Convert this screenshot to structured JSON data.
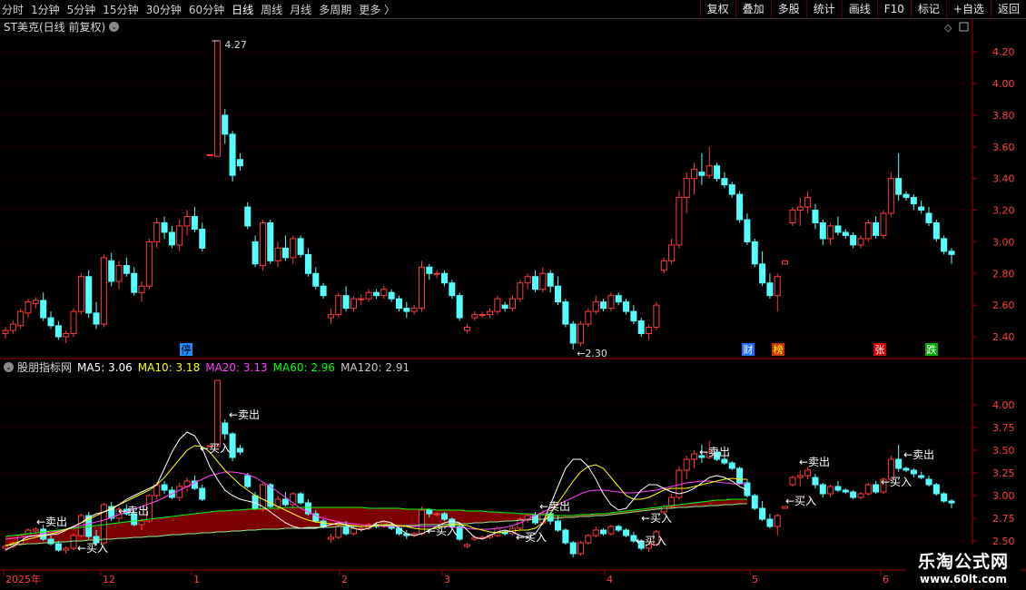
{
  "toolbar": {
    "periods": [
      "分时",
      "1分钟",
      "5分钟",
      "15分钟",
      "30分钟",
      "60分钟",
      "日线",
      "周线",
      "月线",
      "多周期",
      "更多 〉"
    ],
    "active": "日线",
    "right_buttons": [
      "复权",
      "叠加",
      "多股",
      "统计",
      "画线",
      "F10",
      "标记",
      "+自选",
      "返回"
    ]
  },
  "main_panel": {
    "title": "ST美克(日线 前复权)",
    "y_ticks": [
      "4.20",
      "4.00",
      "3.80",
      "3.60",
      "3.40",
      "3.20",
      "3.00",
      "2.80",
      "2.60",
      "2.40"
    ],
    "high_label": "4.27",
    "low_label": "←2.30",
    "markers": [
      "停",
      "财",
      "榜",
      "张",
      "跌"
    ]
  },
  "indicator_panel": {
    "title": "股朋指标网",
    "ma_labels": [
      {
        "text": "MA5: 3.06",
        "color": "#ffffff"
      },
      {
        "text": "MA10: 3.18",
        "color": "#ffff00"
      },
      {
        "text": "MA20: 3.13",
        "color": "#ff40ff"
      },
      {
        "text": "MA60: 2.96",
        "color": "#00ff00"
      },
      {
        "text": "MA120: 2.91",
        "color": "#c8c8c8"
      }
    ],
    "y_ticks": [
      "4.00",
      "3.75",
      "3.50",
      "3.25",
      "3.00",
      "2.75",
      "2.50"
    ],
    "signals": [
      "←卖出",
      "←买入"
    ]
  },
  "x_axis": {
    "labels": [
      "2025年",
      "12",
      "1",
      "2",
      "3",
      "4",
      "5",
      "6"
    ]
  },
  "watermark": {
    "line1": "乐淘公式网",
    "line2": "www.60lt.com"
  },
  "colors": {
    "up": "#ff3b3b",
    "down": "#54ffff",
    "grid": "#5a0000",
    "axis": "#a00000",
    "band": "#8a0000"
  },
  "chart_data": {
    "type": "candlestick",
    "ylim_main": [
      2.3,
      4.27
    ],
    "ylim_indicator": [
      2.5,
      4.0
    ],
    "ohlc": [
      [
        2.42,
        2.46,
        2.39,
        2.44
      ],
      [
        2.44,
        2.5,
        2.42,
        2.48
      ],
      [
        2.47,
        2.58,
        2.45,
        2.56
      ],
      [
        2.55,
        2.64,
        2.52,
        2.62
      ],
      [
        2.61,
        2.65,
        2.58,
        2.63
      ],
      [
        2.63,
        2.68,
        2.5,
        2.52
      ],
      [
        2.52,
        2.56,
        2.45,
        2.47
      ],
      [
        2.47,
        2.5,
        2.38,
        2.4
      ],
      [
        2.4,
        2.44,
        2.36,
        2.42
      ],
      [
        2.42,
        2.58,
        2.4,
        2.56
      ],
      [
        2.56,
        2.8,
        2.54,
        2.78
      ],
      [
        2.78,
        2.82,
        2.52,
        2.55
      ],
      [
        2.55,
        2.62,
        2.45,
        2.48
      ],
      [
        2.48,
        2.92,
        2.46,
        2.9
      ],
      [
        2.88,
        2.93,
        2.72,
        2.75
      ],
      [
        2.75,
        2.88,
        2.7,
        2.85
      ],
      [
        2.85,
        2.9,
        2.78,
        2.8
      ],
      [
        2.8,
        2.84,
        2.66,
        2.68
      ],
      [
        2.68,
        2.75,
        2.62,
        2.72
      ],
      [
        2.72,
        3.02,
        2.7,
        3.0
      ],
      [
        3.0,
        3.15,
        2.96,
        3.12
      ],
      [
        3.12,
        3.16,
        3.02,
        3.06
      ],
      [
        3.06,
        3.1,
        2.96,
        2.98
      ],
      [
        2.98,
        3.14,
        2.94,
        3.1
      ],
      [
        3.1,
        3.2,
        3.04,
        3.16
      ],
      [
        3.16,
        3.22,
        3.06,
        3.08
      ],
      [
        3.08,
        3.12,
        2.94,
        2.96
      ],
      [
        3.55,
        3.55,
        3.55,
        3.55
      ],
      [
        3.54,
        4.27,
        3.54,
        4.27
      ],
      [
        3.8,
        3.84,
        3.62,
        3.68
      ],
      [
        3.68,
        3.7,
        3.38,
        3.42
      ],
      [
        3.52,
        3.56,
        3.45,
        3.48
      ],
      [
        3.22,
        3.25,
        3.08,
        3.1
      ],
      [
        3.0,
        3.04,
        2.84,
        2.86
      ],
      [
        2.85,
        3.14,
        2.82,
        3.12
      ],
      [
        3.12,
        3.14,
        2.86,
        2.88
      ],
      [
        2.88,
        3.0,
        2.84,
        2.96
      ],
      [
        2.96,
        3.04,
        2.88,
        2.9
      ],
      [
        2.9,
        3.04,
        2.86,
        3.02
      ],
      [
        3.02,
        3.04,
        2.9,
        2.92
      ],
      [
        2.92,
        2.96,
        2.78,
        2.8
      ],
      [
        2.8,
        2.84,
        2.7,
        2.72
      ],
      [
        2.72,
        2.74,
        2.64,
        2.66
      ],
      [
        2.52,
        2.58,
        2.48,
        2.54
      ],
      [
        2.54,
        2.68,
        2.52,
        2.66
      ],
      [
        2.66,
        2.72,
        2.56,
        2.58
      ],
      [
        2.58,
        2.66,
        2.56,
        2.64
      ],
      [
        2.64,
        2.67,
        2.6,
        2.64
      ],
      [
        2.64,
        2.7,
        2.62,
        2.68
      ],
      [
        2.68,
        2.7,
        2.64,
        2.66
      ],
      [
        2.66,
        2.72,
        2.64,
        2.7
      ],
      [
        2.68,
        2.7,
        2.62,
        2.64
      ],
      [
        2.64,
        2.66,
        2.56,
        2.58
      ],
      [
        2.58,
        2.62,
        2.52,
        2.56
      ],
      [
        2.56,
        2.6,
        2.54,
        2.58
      ],
      [
        2.58,
        2.88,
        2.56,
        2.84
      ],
      [
        2.84,
        2.86,
        2.76,
        2.8
      ],
      [
        2.8,
        2.82,
        2.77,
        2.8
      ],
      [
        2.8,
        2.82,
        2.72,
        2.74
      ],
      [
        2.74,
        2.76,
        2.64,
        2.66
      ],
      [
        2.66,
        2.68,
        2.5,
        2.52
      ],
      [
        2.44,
        2.48,
        2.42,
        2.46
      ],
      [
        2.52,
        2.56,
        2.5,
        2.54
      ],
      [
        2.54,
        2.56,
        2.52,
        2.54
      ],
      [
        2.54,
        2.58,
        2.52,
        2.56
      ],
      [
        2.56,
        2.66,
        2.54,
        2.64
      ],
      [
        2.6,
        2.62,
        2.56,
        2.58
      ],
      [
        2.58,
        2.66,
        2.56,
        2.64
      ],
      [
        2.64,
        2.76,
        2.62,
        2.74
      ],
      [
        2.74,
        2.8,
        2.7,
        2.78
      ],
      [
        2.78,
        2.82,
        2.68,
        2.7
      ],
      [
        2.7,
        2.84,
        2.68,
        2.8
      ],
      [
        2.8,
        2.82,
        2.68,
        2.72
      ],
      [
        2.72,
        2.78,
        2.6,
        2.62
      ],
      [
        2.62,
        2.64,
        2.46,
        2.48
      ],
      [
        2.48,
        2.5,
        2.32,
        2.36
      ],
      [
        2.36,
        2.5,
        2.34,
        2.48
      ],
      [
        2.48,
        2.58,
        2.46,
        2.56
      ],
      [
        2.56,
        2.66,
        2.54,
        2.62
      ],
      [
        2.62,
        2.64,
        2.56,
        2.58
      ],
      [
        2.58,
        2.68,
        2.56,
        2.66
      ],
      [
        2.66,
        2.68,
        2.6,
        2.62
      ],
      [
        2.62,
        2.64,
        2.54,
        2.56
      ],
      [
        2.56,
        2.6,
        2.48,
        2.5
      ],
      [
        2.5,
        2.52,
        2.4,
        2.42
      ],
      [
        2.42,
        2.48,
        2.38,
        2.46
      ],
      [
        2.46,
        2.62,
        2.44,
        2.6
      ],
      [
        2.82,
        2.9,
        2.8,
        2.88
      ],
      [
        2.88,
        3.02,
        2.86,
        2.98
      ],
      [
        2.98,
        3.32,
        2.96,
        3.28
      ],
      [
        3.28,
        3.44,
        3.18,
        3.4
      ],
      [
        3.4,
        3.5,
        3.3,
        3.46
      ],
      [
        3.44,
        3.56,
        3.36,
        3.42
      ],
      [
        3.42,
        3.6,
        3.4,
        3.48
      ],
      [
        3.48,
        3.5,
        3.38,
        3.4
      ],
      [
        3.4,
        3.44,
        3.34,
        3.36
      ],
      [
        3.36,
        3.38,
        3.28,
        3.3
      ],
      [
        3.3,
        3.32,
        3.12,
        3.14
      ],
      [
        3.14,
        3.18,
        2.98,
        3.0
      ],
      [
        3.0,
        3.02,
        2.84,
        2.86
      ],
      [
        2.86,
        2.94,
        2.72,
        2.74
      ],
      [
        2.74,
        2.8,
        2.64,
        2.66
      ],
      [
        2.66,
        2.8,
        2.56,
        2.78
      ],
      [
        2.86,
        2.88,
        2.86,
        2.88
      ],
      [
        3.12,
        3.22,
        3.1,
        3.2
      ],
      [
        3.2,
        3.28,
        3.1,
        3.22
      ],
      [
        3.22,
        3.32,
        3.18,
        3.28
      ],
      [
        3.2,
        3.24,
        3.08,
        3.12
      ],
      [
        3.12,
        3.14,
        2.98,
        3.02
      ],
      [
        3.02,
        3.12,
        2.98,
        3.1
      ],
      [
        3.1,
        3.16,
        3.04,
        3.06
      ],
      [
        3.06,
        3.08,
        3.02,
        3.04
      ],
      [
        3.04,
        3.06,
        2.96,
        2.98
      ],
      [
        2.98,
        3.04,
        2.96,
        3.02
      ],
      [
        3.02,
        3.14,
        3.0,
        3.12
      ],
      [
        3.12,
        3.16,
        3.02,
        3.04
      ],
      [
        3.04,
        3.2,
        3.02,
        3.18
      ],
      [
        3.18,
        3.44,
        3.16,
        3.4
      ],
      [
        3.4,
        3.56,
        3.26,
        3.3
      ],
      [
        3.3,
        3.32,
        3.26,
        3.28
      ],
      [
        3.28,
        3.3,
        3.2,
        3.24
      ],
      [
        3.22,
        3.26,
        3.18,
        3.2
      ],
      [
        3.18,
        3.22,
        3.1,
        3.12
      ],
      [
        3.12,
        3.14,
        3.0,
        3.02
      ],
      [
        3.02,
        3.04,
        2.92,
        2.94
      ],
      [
        2.94,
        2.96,
        2.86,
        2.92
      ]
    ],
    "ma5": [
      2.4,
      2.44,
      2.5,
      2.55,
      2.56,
      2.56,
      2.57,
      2.58,
      2.62,
      2.66,
      2.7,
      2.76,
      2.8,
      2.82,
      2.85,
      2.9,
      2.96,
      3.0,
      3.04,
      3.08,
      3.12,
      3.3,
      3.48,
      3.62,
      3.7,
      3.66,
      3.52,
      3.32,
      3.18,
      3.06,
      3.0,
      2.96,
      2.94,
      2.92,
      2.88,
      2.82,
      2.76,
      2.7,
      2.66,
      2.64,
      2.64,
      2.64,
      2.66,
      2.68,
      2.7,
      2.68,
      2.64,
      2.62,
      2.64,
      2.7,
      2.72,
      2.7,
      2.64,
      2.58,
      2.56,
      2.58,
      2.62,
      2.66,
      2.7,
      2.72,
      2.7,
      2.62,
      2.54,
      2.52,
      2.56,
      2.6,
      2.62,
      2.6,
      2.56,
      2.54,
      2.58,
      2.7,
      2.9,
      3.1,
      3.3,
      3.4,
      3.4,
      3.32,
      3.18,
      3.02,
      2.9,
      2.84,
      2.86,
      2.96,
      3.06,
      3.12,
      3.12,
      3.08,
      3.04,
      3.02,
      3.04,
      3.08,
      3.14,
      3.2,
      3.22,
      3.2,
      3.16,
      3.1,
      3.06
    ],
    "ma10": [
      2.45,
      2.47,
      2.5,
      2.52,
      2.54,
      2.56,
      2.58,
      2.6,
      2.63,
      2.66,
      2.7,
      2.74,
      2.78,
      2.82,
      2.86,
      2.9,
      2.94,
      2.98,
      3.02,
      3.06,
      3.12,
      3.2,
      3.3,
      3.4,
      3.5,
      3.55,
      3.54,
      3.48,
      3.38,
      3.28,
      3.2,
      3.12,
      3.06,
      3.0,
      2.96,
      2.92,
      2.88,
      2.84,
      2.8,
      2.76,
      2.73,
      2.71,
      2.7,
      2.69,
      2.68,
      2.68,
      2.67,
      2.66,
      2.66,
      2.67,
      2.68,
      2.68,
      2.67,
      2.66,
      2.64,
      2.63,
      2.63,
      2.64,
      2.66,
      2.68,
      2.68,
      2.67,
      2.64,
      2.62,
      2.6,
      2.59,
      2.6,
      2.61,
      2.62,
      2.62,
      2.64,
      2.7,
      2.8,
      2.92,
      3.04,
      3.16,
      3.26,
      3.32,
      3.34,
      3.3,
      3.2,
      3.1,
      3.0,
      2.96,
      2.96,
      2.98,
      3.02,
      3.06,
      3.08,
      3.08,
      3.08,
      3.1,
      3.12,
      3.14,
      3.16,
      3.18,
      3.19,
      3.18,
      3.18
    ],
    "ma20": [
      2.52,
      2.53,
      2.54,
      2.55,
      2.56,
      2.58,
      2.6,
      2.61,
      2.63,
      2.65,
      2.67,
      2.69,
      2.71,
      2.73,
      2.76,
      2.79,
      2.82,
      2.85,
      2.88,
      2.91,
      2.94,
      2.98,
      3.02,
      3.06,
      3.1,
      3.14,
      3.18,
      3.22,
      3.24,
      3.26,
      3.26,
      3.25,
      3.23,
      3.2,
      3.15,
      3.1,
      3.04,
      2.98,
      2.92,
      2.86,
      2.82,
      2.78,
      2.75,
      2.73,
      2.71,
      2.7,
      2.69,
      2.68,
      2.67,
      2.67,
      2.66,
      2.66,
      2.66,
      2.66,
      2.66,
      2.66,
      2.66,
      2.66,
      2.66,
      2.65,
      2.65,
      2.64,
      2.63,
      2.63,
      2.63,
      2.64,
      2.65,
      2.67,
      2.7,
      2.74,
      2.78,
      2.82,
      2.86,
      2.9,
      2.94,
      2.98,
      3.02,
      3.05,
      3.06,
      3.06,
      3.05,
      3.04,
      3.03,
      3.03,
      3.04,
      3.05,
      3.06,
      3.08,
      3.1,
      3.12,
      3.14,
      3.15,
      3.16,
      3.16,
      3.15,
      3.14,
      3.13,
      3.13,
      3.13
    ],
    "ma60": [
      2.55,
      2.56,
      2.57,
      2.58,
      2.59,
      2.6,
      2.61,
      2.62,
      2.63,
      2.64,
      2.65,
      2.66,
      2.67,
      2.68,
      2.69,
      2.7,
      2.71,
      2.72,
      2.73,
      2.74,
      2.75,
      2.76,
      2.77,
      2.78,
      2.79,
      2.8,
      2.81,
      2.82,
      2.83,
      2.83,
      2.84,
      2.84,
      2.85,
      2.85,
      2.86,
      2.86,
      2.86,
      2.87,
      2.87,
      2.87,
      2.87,
      2.87,
      2.87,
      2.87,
      2.87,
      2.87,
      2.87,
      2.87,
      2.86,
      2.86,
      2.86,
      2.86,
      2.86,
      2.85,
      2.85,
      2.85,
      2.85,
      2.84,
      2.84,
      2.84,
      2.84,
      2.83,
      2.83,
      2.83,
      2.82,
      2.82,
      2.81,
      2.81,
      2.8,
      2.8,
      2.79,
      2.79,
      2.78,
      2.78,
      2.78,
      2.78,
      2.79,
      2.79,
      2.8,
      2.8,
      2.81,
      2.82,
      2.83,
      2.84,
      2.85,
      2.86,
      2.87,
      2.88,
      2.89,
      2.9,
      2.91,
      2.92,
      2.93,
      2.94,
      2.95,
      2.95,
      2.96,
      2.96,
      2.96
    ],
    "ma120": [
      2.45,
      2.46,
      2.46,
      2.47,
      2.47,
      2.48,
      2.48,
      2.49,
      2.49,
      2.5,
      2.5,
      2.51,
      2.51,
      2.52,
      2.52,
      2.53,
      2.53,
      2.54,
      2.54,
      2.55,
      2.55,
      2.56,
      2.57,
      2.57,
      2.58,
      2.58,
      2.59,
      2.59,
      2.6,
      2.6,
      2.61,
      2.61,
      2.62,
      2.62,
      2.63,
      2.63,
      2.63,
      2.64,
      2.64,
      2.64,
      2.65,
      2.65,
      2.65,
      2.65,
      2.66,
      2.66,
      2.66,
      2.66,
      2.66,
      2.66,
      2.67,
      2.67,
      2.67,
      2.67,
      2.67,
      2.68,
      2.68,
      2.68,
      2.68,
      2.69,
      2.69,
      2.69,
      2.7,
      2.7,
      2.71,
      2.71,
      2.72,
      2.72,
      2.73,
      2.73,
      2.74,
      2.74,
      2.75,
      2.75,
      2.76,
      2.76,
      2.77,
      2.77,
      2.78,
      2.78,
      2.79,
      2.8,
      2.81,
      2.82,
      2.83,
      2.84,
      2.85,
      2.86,
      2.86,
      2.87,
      2.87,
      2.88,
      2.88,
      2.89,
      2.89,
      2.9,
      2.9,
      2.91,
      2.91
    ]
  }
}
